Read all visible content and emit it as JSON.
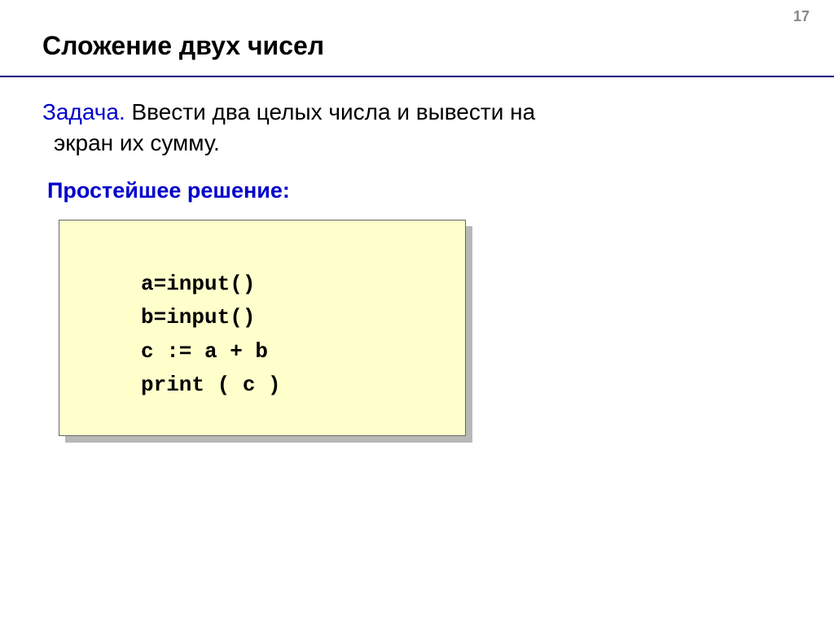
{
  "pageNumber": "17",
  "title": "Сложение двух чисел",
  "taskLabel": "Задача.",
  "taskTextLine1": " Ввести два целых числа и вывести на",
  "taskTextLine2": "экран их сумму.",
  "solutionLabel": "Простейшее решение:",
  "code": {
    "line1": "a=input()",
    "line2": "b=input()",
    "line3": "c := a + b",
    "line4": "print ( c )"
  }
}
